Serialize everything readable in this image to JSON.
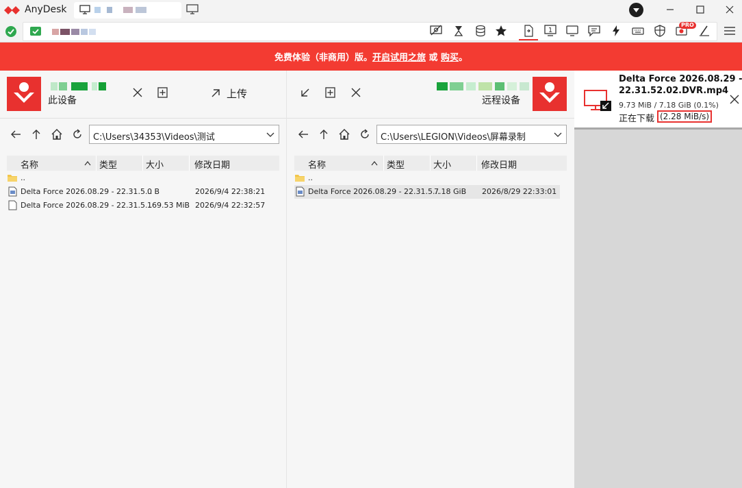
{
  "app": {
    "title": "AnyDesk"
  },
  "banner": {
    "text_before": "免费体验（非商用）版。",
    "link_trial": "开启试用之旅",
    "text_or": " 或 ",
    "link_buy": "购买",
    "text_end": "。"
  },
  "local": {
    "device_label": "此设备",
    "upload_label": "上传",
    "path": "C:\\Users\\34353\\Videos\\测试",
    "columns": [
      "名称",
      "类型",
      "大小",
      "修改日期"
    ],
    "parent_dir": "..",
    "files": [
      {
        "name": "Delta Force 2026.08.29 - 22.31.5...",
        "type": "",
        "size": "0 B",
        "modified": "2026/9/4 22:38:21",
        "icon": "video-file-icon"
      },
      {
        "name": "Delta Force 2026.08.29 - 22.31.5...",
        "type": "",
        "size": "169.53 MiB",
        "modified": "2026/9/4 22:32:57",
        "icon": "blank-file-icon"
      }
    ]
  },
  "remote": {
    "device_label": "远程设备",
    "path": "C:\\Users\\LEGION\\Videos\\屏幕录制",
    "columns": [
      "名称",
      "类型",
      "大小",
      "修改日期"
    ],
    "parent_dir": "..",
    "files": [
      {
        "name": "Delta Force 2026.08.29 - 22.31.5...",
        "type": "",
        "size": "7.18 GiB",
        "modified": "2026/8/29 22:33:01",
        "icon": "video-file-icon"
      }
    ]
  },
  "transfer": {
    "filename_line1": "Delta Force 2026.08.29 -",
    "filename_line2": "22.31.52.02.DVR.mp4",
    "size_progress": "9.73 MiB / 7.18 GiB (0.1%)",
    "progress_percent": 0.1,
    "status": "正在下载",
    "speed": "(2.28 MiB/s)"
  },
  "toolbar": {
    "pro_badge": "PRO"
  },
  "colors": {
    "accent": "#e8312f",
    "banner": "#f33b32",
    "connected": "#2fa84f"
  }
}
